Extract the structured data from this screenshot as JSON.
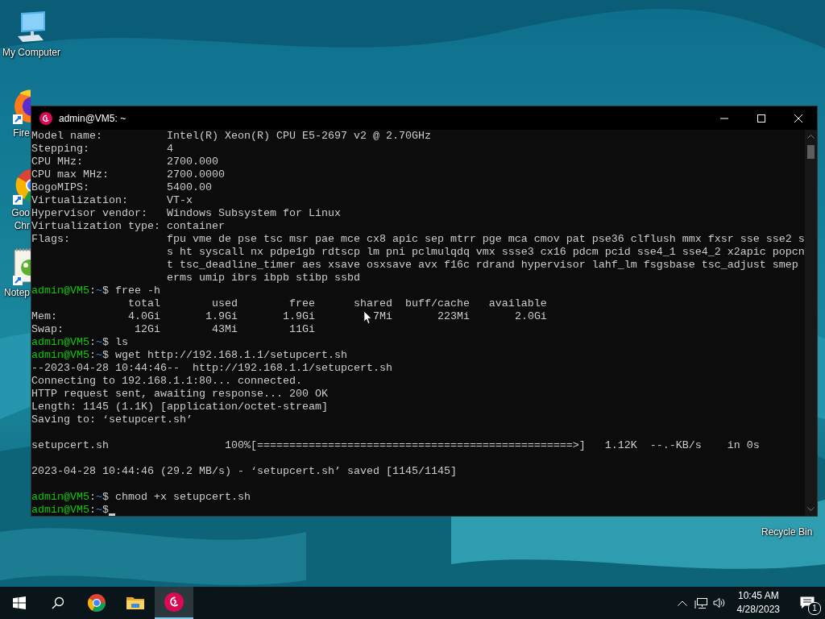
{
  "desktop": {
    "icons": [
      {
        "kind": "computer",
        "lines": [
          "My Computer"
        ]
      },
      {
        "kind": "firefox",
        "lines": [
          "Fire"
        ]
      },
      {
        "kind": "chrome",
        "lines": [
          "Goo",
          "Chr"
        ]
      },
      {
        "kind": "notepad",
        "lines": [
          "Notep"
        ]
      },
      {
        "kind": "recycle",
        "lines": [
          "Recycle Bin"
        ]
      }
    ]
  },
  "window": {
    "title": "admin@VM5: ~",
    "lines": [
      {
        "kind": "output",
        "text": "Model name:          Intel(R) Xeon(R) CPU E5-2697 v2 @ 2.70GHz"
      },
      {
        "kind": "output",
        "text": "Stepping:            4"
      },
      {
        "kind": "output",
        "text": "CPU MHz:             2700.000"
      },
      {
        "kind": "output",
        "text": "CPU max MHz:         2700.0000"
      },
      {
        "kind": "output",
        "text": "BogoMIPS:            5400.00"
      },
      {
        "kind": "output",
        "text": "Virtualization:      VT-x"
      },
      {
        "kind": "output",
        "text": "Hypervisor vendor:   Windows Subsystem for Linux"
      },
      {
        "kind": "output",
        "text": "Virtualization type: container"
      },
      {
        "kind": "output",
        "text": "Flags:               fpu vme de pse tsc msr pae mce cx8 apic sep mtrr pge mca cmov pat pse36 clflush mmx fxsr sse sse2 s"
      },
      {
        "kind": "output",
        "text": "                     s ht syscall nx pdpe1gb rdtscp lm pni pclmulqdq vmx ssse3 cx16 pdcm pcid sse4_1 sse4_2 x2apic popcn"
      },
      {
        "kind": "output",
        "text": "                     t tsc_deadline_timer aes xsave osxsave avx f16c rdrand hypervisor lahf_lm fsgsbase tsc_adjust smep"
      },
      {
        "kind": "output",
        "text": "                     erms umip ibrs ibpb stibp ssbd"
      },
      {
        "kind": "prompt",
        "user": "admin@VM5",
        "sep": ":",
        "path": "~",
        "symbol": "$",
        "command": "free -h",
        "cursor": false
      },
      {
        "kind": "output",
        "text": "               total        used        free      shared  buff/cache   available"
      },
      {
        "kind": "split",
        "left": "Mem:           4.0Gi       1.9Gi       1.9Gi",
        "right": "7Mi       223Mi       2.0Gi"
      },
      {
        "kind": "output",
        "text": "Swap:           12Gi        43Mi        11Gi"
      },
      {
        "kind": "prompt",
        "user": "admin@VM5",
        "sep": ":",
        "path": "~",
        "symbol": "$",
        "command": "ls",
        "cursor": false
      },
      {
        "kind": "prompt",
        "user": "admin@VM5",
        "sep": ":",
        "path": "~",
        "symbol": "$",
        "command": "wget http://192.168.1.1/setupcert.sh",
        "cursor": false
      },
      {
        "kind": "output",
        "text": "--2023-04-28 10:44:46--  http://192.168.1.1/setupcert.sh"
      },
      {
        "kind": "output",
        "text": "Connecting to 192.168.1.1:80... connected."
      },
      {
        "kind": "output",
        "text": "HTTP request sent, awaiting response... 200 OK"
      },
      {
        "kind": "output",
        "text": "Length: 1145 (1.1K) [application/octet-stream]"
      },
      {
        "kind": "output",
        "text": "Saving to: ‘setupcert.sh’"
      },
      {
        "kind": "blank"
      },
      {
        "kind": "output",
        "text": "setupcert.sh                  100%[=================================================>]   1.12K  --.-KB/s    in 0s"
      },
      {
        "kind": "blank"
      },
      {
        "kind": "output",
        "text": "2023-04-28 10:44:46 (29.2 MB/s) - ‘setupcert.sh’ saved [1145/1145]"
      },
      {
        "kind": "blank"
      },
      {
        "kind": "prompt",
        "user": "admin@VM5",
        "sep": ":",
        "path": "~",
        "symbol": "$",
        "command": "chmod +x setupcert.sh",
        "cursor": false
      },
      {
        "kind": "prompt",
        "user": "admin@VM5",
        "sep": ":",
        "path": "~",
        "symbol": "$",
        "cursor": true
      }
    ]
  },
  "taskbar": {
    "apps": [
      {
        "kind": "start",
        "active": false
      },
      {
        "kind": "search",
        "active": false
      },
      {
        "kind": "chrome",
        "active": false
      },
      {
        "kind": "explorer",
        "active": false
      },
      {
        "kind": "terminal",
        "active": true
      }
    ],
    "tray": {
      "time": "10:45 AM",
      "date": "4/28/2023",
      "notifications": "1"
    }
  }
}
